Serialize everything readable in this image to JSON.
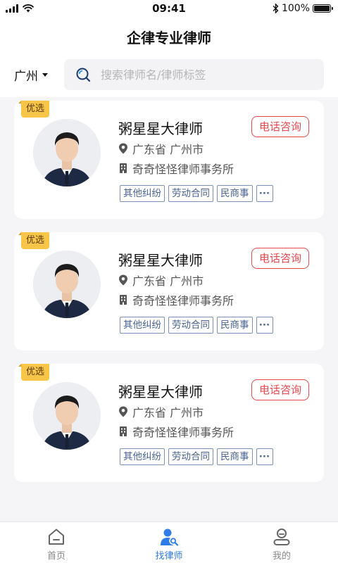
{
  "status_bar": {
    "time": "09:41",
    "battery": "100%"
  },
  "header": {
    "title": "企律专业律师",
    "city": "广州",
    "search_placeholder": "搜索律师名/律师标签"
  },
  "lawyers": [
    {
      "badge": "优选",
      "name": "粥星星大律师",
      "call_label": "电话咨询",
      "location": "广东省 广州市",
      "firm": "奇奇怪怪律师事务所",
      "tags": [
        "其他纠纷",
        "劳动合同",
        "民商事"
      ],
      "more": "···"
    },
    {
      "badge": "优选",
      "name": "粥星星大律师",
      "call_label": "电话咨询",
      "location": "广东省 广州市",
      "firm": "奇奇怪怪律师事务所",
      "tags": [
        "其他纠纷",
        "劳动合同",
        "民商事"
      ],
      "more": "···"
    },
    {
      "badge": "优选",
      "name": "粥星星大律师",
      "call_label": "电话咨询",
      "location": "广东省 广州市",
      "firm": "奇奇怪怪律师事务所",
      "tags": [
        "其他纠纷",
        "劳动合同",
        "民商事"
      ],
      "more": "···"
    }
  ],
  "tabbar": {
    "items": [
      {
        "label": "首页",
        "icon": "home-icon",
        "active": false
      },
      {
        "label": "找律师",
        "icon": "find-lawyer-icon",
        "active": true
      },
      {
        "label": "我的",
        "icon": "profile-icon",
        "active": false
      }
    ]
  },
  "colors": {
    "accent": "#2f7ce6",
    "call": "#e8484d",
    "badge": "#f7c547",
    "tag": "#4a6491"
  }
}
